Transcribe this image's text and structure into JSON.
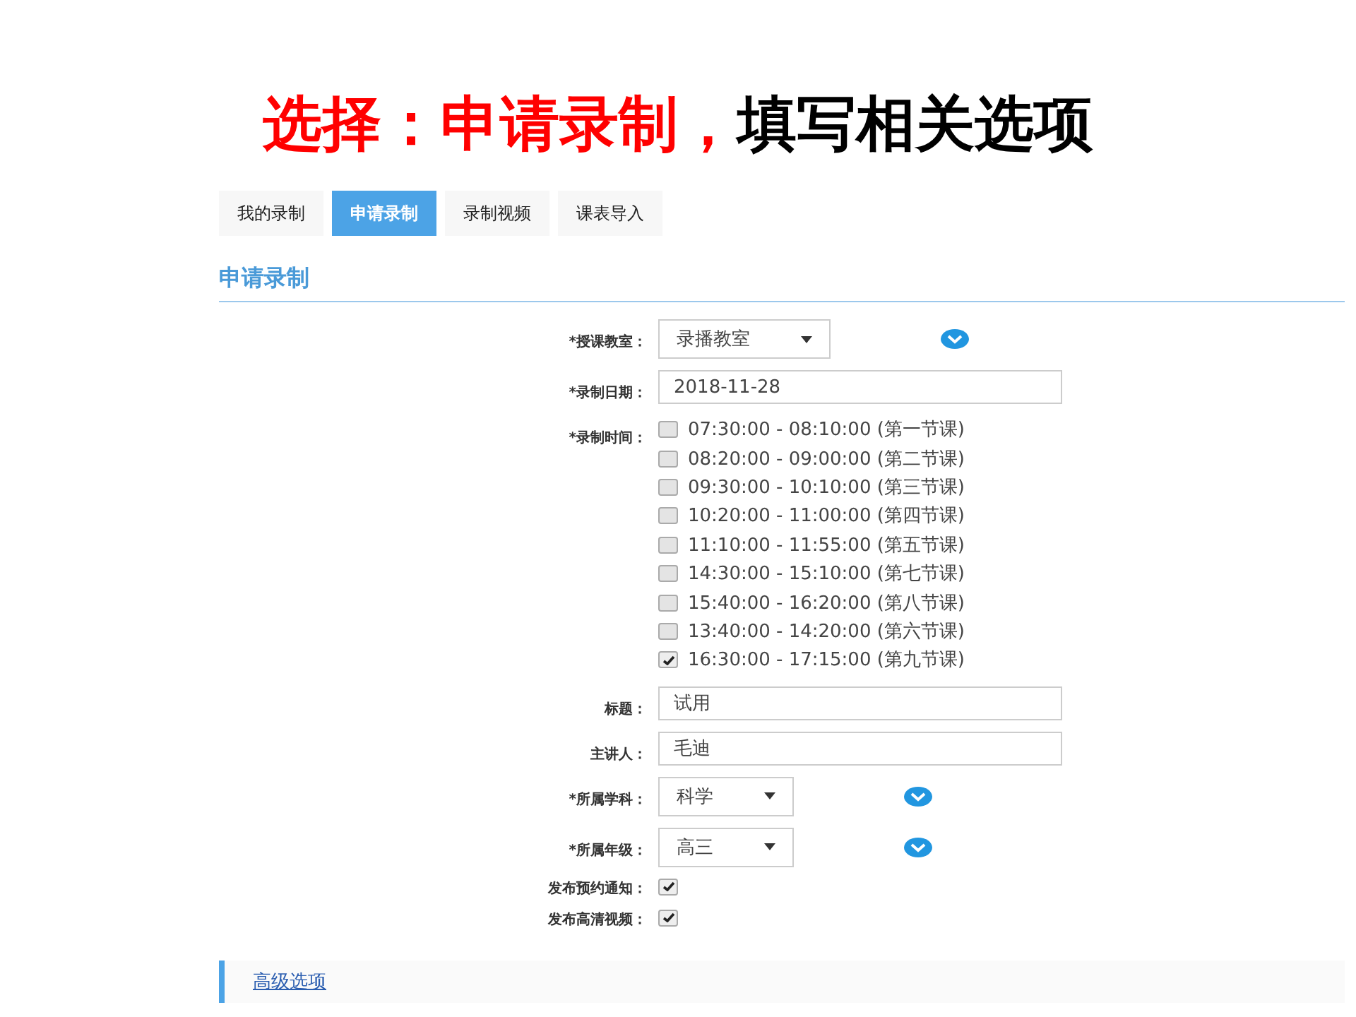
{
  "slide_title": [
    {
      "text": "选择：申请录制，",
      "color": "#ff0000"
    },
    {
      "text": "填写相关选项",
      "color": "#000000"
    }
  ],
  "tabs": [
    {
      "label": "我的录制",
      "selected": false
    },
    {
      "label": "申请录制",
      "selected": true
    },
    {
      "label": "录制视频",
      "selected": false
    },
    {
      "label": "课表导入",
      "selected": false
    }
  ],
  "section_title": "申请录制",
  "form": [
    {
      "kind": "select",
      "label": "*授课教室：",
      "value": "录播教室"
    },
    {
      "kind": "input",
      "label": "*录制日期：",
      "value": "2018-11-28"
    },
    {
      "kind": "checklist",
      "label": "*录制时间：",
      "options": [
        {
          "label": "07:30:00 - 08:10:00 (第一节课)",
          "checked": false
        },
        {
          "label": "08:20:00 - 09:00:00 (第二节课)",
          "checked": false
        },
        {
          "label": "09:30:00 - 10:10:00 (第三节课)",
          "checked": false
        },
        {
          "label": "10:20:00 - 11:00:00 (第四节课)",
          "checked": false
        },
        {
          "label": "11:10:00 - 11:55:00 (第五节课)",
          "checked": false
        },
        {
          "label": "14:30:00 - 15:10:00 (第七节课)",
          "checked": false
        },
        {
          "label": "15:40:00 - 16:20:00 (第八节课)",
          "checked": false
        },
        {
          "label": "13:40:00 - 14:20:00 (第六节课)",
          "checked": false
        },
        {
          "label": "16:30:00 - 17:15:00 (第九节课)",
          "checked": true
        }
      ]
    },
    {
      "kind": "input",
      "label": "标题：",
      "value": "试用"
    },
    {
      "kind": "input",
      "label": "主讲人：",
      "value": "毛迪"
    },
    {
      "kind": "select",
      "label": "*所属学科：",
      "value": "科学"
    },
    {
      "kind": "select",
      "label": "*所属年级：",
      "value": "高三"
    },
    {
      "kind": "checkbox",
      "label": "发布预约通知：",
      "checked": true
    },
    {
      "kind": "checkbox",
      "label": "发布高清视频：",
      "checked": true
    }
  ],
  "advanced_link": "高级选项"
}
